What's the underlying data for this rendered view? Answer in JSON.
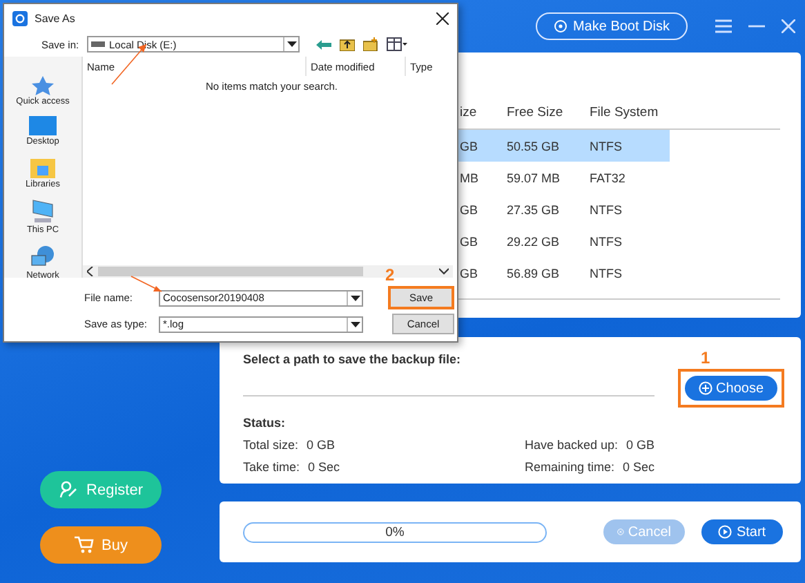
{
  "dialog": {
    "title": "Save As",
    "save_in_label": "Save in:",
    "save_in_value": "Local Disk (E:)",
    "nav_items": [
      {
        "label": "Quick access",
        "kind": "star"
      },
      {
        "label": "Desktop",
        "kind": "desktop"
      },
      {
        "label": "Libraries",
        "kind": "folder"
      },
      {
        "label": "This PC",
        "kind": "pc"
      },
      {
        "label": "Network",
        "kind": "network"
      }
    ],
    "columns": [
      "Name",
      "Date modified",
      "Type"
    ],
    "empty_message": "No items match your search.",
    "file_name_label": "File name:",
    "file_name": "Cocosensor20190408",
    "save_type_label": "Save as type:",
    "save_type": "*.log",
    "buttons": [
      {
        "label": "Save",
        "highlighted": true,
        "annotation": "2"
      },
      {
        "label": "Cancel",
        "highlighted": false
      }
    ]
  },
  "header": {
    "boot_button": "Make Boot Disk"
  },
  "disk_table": {
    "columns": [
      "ize",
      "Free Size",
      "File System"
    ],
    "rows": [
      {
        "cells": [
          "GB",
          "50.55 GB",
          "NTFS"
        ],
        "selected": true
      },
      {
        "cells": [
          "MB",
          "59.07 MB",
          "FAT32"
        ],
        "selected": false
      },
      {
        "cells": [
          "GB",
          "27.35 GB",
          "NTFS"
        ],
        "selected": false
      },
      {
        "cells": [
          "GB",
          "29.22 GB",
          "NTFS"
        ],
        "selected": false
      },
      {
        "cells": [
          "GB",
          "56.89 GB",
          "NTFS"
        ],
        "selected": false
      }
    ]
  },
  "backup": {
    "prompt": "Select a path to save the backup file:",
    "choose_button": {
      "label": "Choose",
      "highlighted": true,
      "annotation": "1"
    },
    "status_title": "Status:",
    "stats": [
      {
        "label": "Total size:",
        "value": "0 GB"
      },
      {
        "label": "Have backed up:",
        "value": "0 GB"
      },
      {
        "label": "Take time:",
        "value": "0 Sec"
      },
      {
        "label": "Remaining time:",
        "value": "0 Sec"
      }
    ]
  },
  "progress": {
    "level": 0,
    "reading": "0%",
    "cancel": {
      "label": "Cancel",
      "disabled": true
    },
    "start": {
      "label": "Start",
      "disabled": false
    }
  },
  "sidebar": {
    "register": "Register",
    "buy": "Buy"
  }
}
